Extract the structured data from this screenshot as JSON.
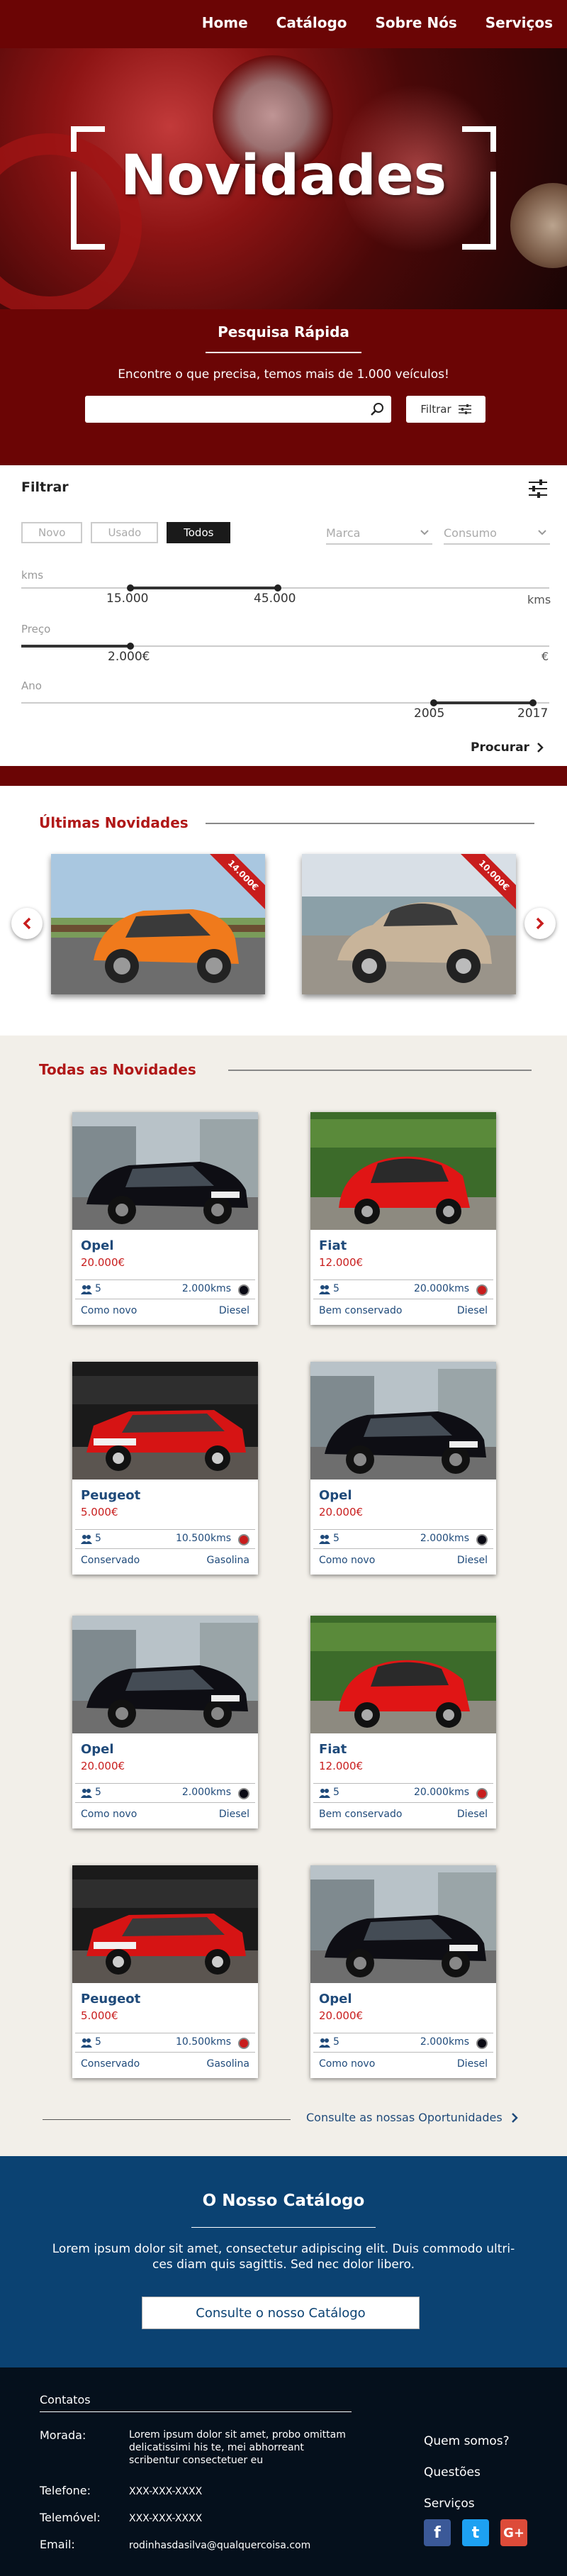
{
  "nav": {
    "items": [
      "Home",
      "Catálogo",
      "Sobre Nós",
      "Serviços"
    ]
  },
  "hero": {
    "title": "Novidades"
  },
  "quick_search": {
    "title": "Pesquisa Rápida",
    "subtitle": "Encontre o que precisa, temos mais de 1.000 veículos!",
    "search_value": "",
    "filter_label": "Filtrar"
  },
  "filter": {
    "title": "Filtrar",
    "condition_buttons": [
      {
        "label": "Novo",
        "active": false
      },
      {
        "label": "Usado",
        "active": false
      },
      {
        "label": "Todos",
        "active": true
      }
    ],
    "brand_select": "Marca",
    "model_select": "Consumo",
    "kms": {
      "label": "kms",
      "min": "15.000",
      "max": "45.000",
      "unit": "kms"
    },
    "price": {
      "label": "Preço",
      "min": "2.000€",
      "unit": "€"
    },
    "year": {
      "label": "Ano",
      "min": "2005",
      "max": "2017"
    },
    "submit_label": "Procurar"
  },
  "latest": {
    "title": "Últimas Novidades",
    "items": [
      {
        "badge": "14.000€",
        "model": "smart",
        "color": "#f07a1c"
      },
      {
        "badge": "10.000€",
        "model": "porsche",
        "color": "#c8b49a"
      }
    ]
  },
  "all": {
    "title": "Todas as Novidades",
    "cars": [
      {
        "name": "Opel",
        "price": "20.000€",
        "seats": "5",
        "kms": "2.000kms",
        "condition": "Como novo",
        "fuel": "Diesel",
        "color": "#0a0a14",
        "img": "black"
      },
      {
        "name": "Fiat",
        "price": "12.000€",
        "seats": "5",
        "kms": "20.000kms",
        "condition": "Bem conservado",
        "fuel": "Diesel",
        "color": "#c81d1d",
        "img": "red-fiat"
      },
      {
        "name": "Peugeot",
        "price": "5.000€",
        "seats": "5",
        "kms": "10.500kms",
        "condition": "Conservado",
        "fuel": "Gasolina",
        "color": "#c81d1d",
        "img": "red-peugeot"
      },
      {
        "name": "Opel",
        "price": "20.000€",
        "seats": "5",
        "kms": "2.000kms",
        "condition": "Como novo",
        "fuel": "Diesel",
        "color": "#0a0a14",
        "img": "black"
      },
      {
        "name": "Opel",
        "price": "20.000€",
        "seats": "5",
        "kms": "2.000kms",
        "condition": "Como novo",
        "fuel": "Diesel",
        "color": "#0a0a14",
        "img": "black"
      },
      {
        "name": "Fiat",
        "price": "12.000€",
        "seats": "5",
        "kms": "20.000kms",
        "condition": "Bem conservado",
        "fuel": "Diesel",
        "color": "#c81d1d",
        "img": "red-fiat"
      },
      {
        "name": "Peugeot",
        "price": "5.000€",
        "seats": "5",
        "kms": "10.500kms",
        "condition": "Conservado",
        "fuel": "Gasolina",
        "color": "#c81d1d",
        "img": "red-peugeot"
      },
      {
        "name": "Opel",
        "price": "20.000€",
        "seats": "5",
        "kms": "2.000kms",
        "condition": "Como novo",
        "fuel": "Diesel",
        "color": "#0a0a14",
        "img": "black"
      }
    ],
    "more_link": "Consulte as nossas Oportunidades"
  },
  "catalog": {
    "title": "O Nosso Catálogo",
    "text": "Lorem ipsum dolor sit amet, consectetur adipiscing elit. Duis commodo ultri-ces diam quis sagittis. Sed nec dolor libero.",
    "button": "Consulte o nosso Catálogo"
  },
  "footer": {
    "title": "Contatos",
    "morada_label": "Morada:",
    "morada": "Lorem ipsum dolor sit amet, probo omittam delicatissimi his te, mei abhorreant scribentur consectetuer eu",
    "telefone_label": "Telefone:",
    "telefone": "XXX-XXX-XXXX",
    "telemovel_label": "Telemóvel:",
    "telemovel": "XXX-XXX-XXXX",
    "email_label": "Email:",
    "email": "rodinhasdasilva@qualquercoisa.com",
    "links": [
      "Quem somos?",
      "Questões",
      "Serviços"
    ],
    "social": [
      {
        "name": "facebook",
        "glyph": "f",
        "color": "#3b5998"
      },
      {
        "name": "twitter",
        "glyph": "t",
        "color": "#1da1f2"
      },
      {
        "name": "google-plus",
        "glyph": "G+",
        "color": "#dd4b39"
      }
    ]
  }
}
